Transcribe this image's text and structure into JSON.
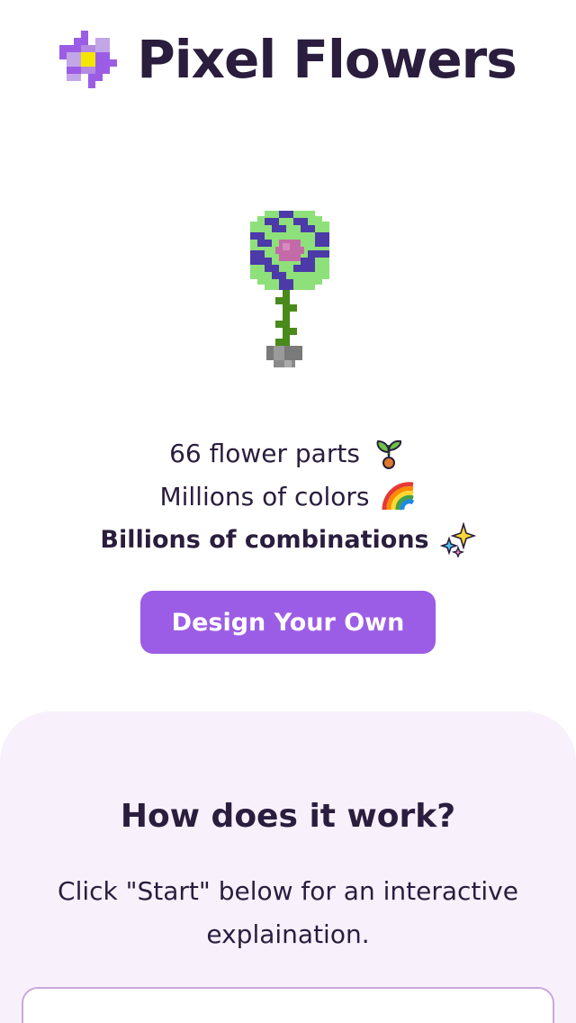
{
  "header": {
    "title": "Pixel Flowers",
    "logo_icon": "pixel-flower-logo-icon"
  },
  "hero": {
    "flower_icon": "pixel-flower-illustration"
  },
  "features": {
    "line1": "66 flower parts",
    "line1_icon": "seedling-emoji",
    "line2": "Millions of colors",
    "line2_icon": "rainbow-emoji",
    "line3": "Billions of combinations",
    "line3_icon": "sparkles-emoji"
  },
  "cta": {
    "label": "Design Your Own"
  },
  "how": {
    "title": "How does it work?",
    "description": "Click \"Start\" below for an interactive explaination."
  },
  "colors": {
    "accent": "#9b5de5",
    "text": "#2a1d3d",
    "section_bg": "#f8f1fc",
    "box_border": "#c9a8dc"
  }
}
